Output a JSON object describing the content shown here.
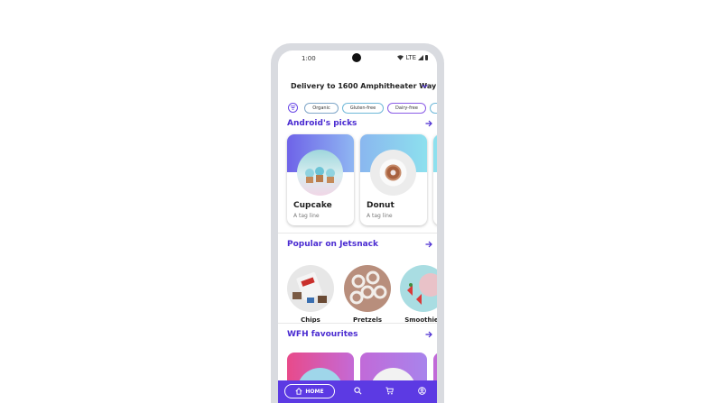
{
  "status": {
    "time": "1:00",
    "network": "LTE"
  },
  "delivery": {
    "label": "Delivery to 1600 Amphitheater Way"
  },
  "filters": [
    "Organic",
    "Gluten-free",
    "Dairy-free"
  ],
  "sections": {
    "picks": "Android's picks",
    "popular": "Popular on Jetsnack",
    "wfh": "WFH favourites"
  },
  "picks": [
    {
      "name": "Cupcake",
      "tagline": "A tag line"
    },
    {
      "name": "Donut",
      "tagline": "A tag line"
    }
  ],
  "popular": [
    "Chips",
    "Pretzels",
    "Smoothies"
  ],
  "nav": {
    "home_label": "HOME"
  },
  "colors": {
    "accent": "#4a2bd1",
    "navbar": "#5c3ae3"
  },
  "icons": [
    "filter-icon",
    "arrow-right-icon",
    "chevron-down-icon",
    "home-icon",
    "search-icon",
    "cart-icon",
    "profile-icon"
  ]
}
